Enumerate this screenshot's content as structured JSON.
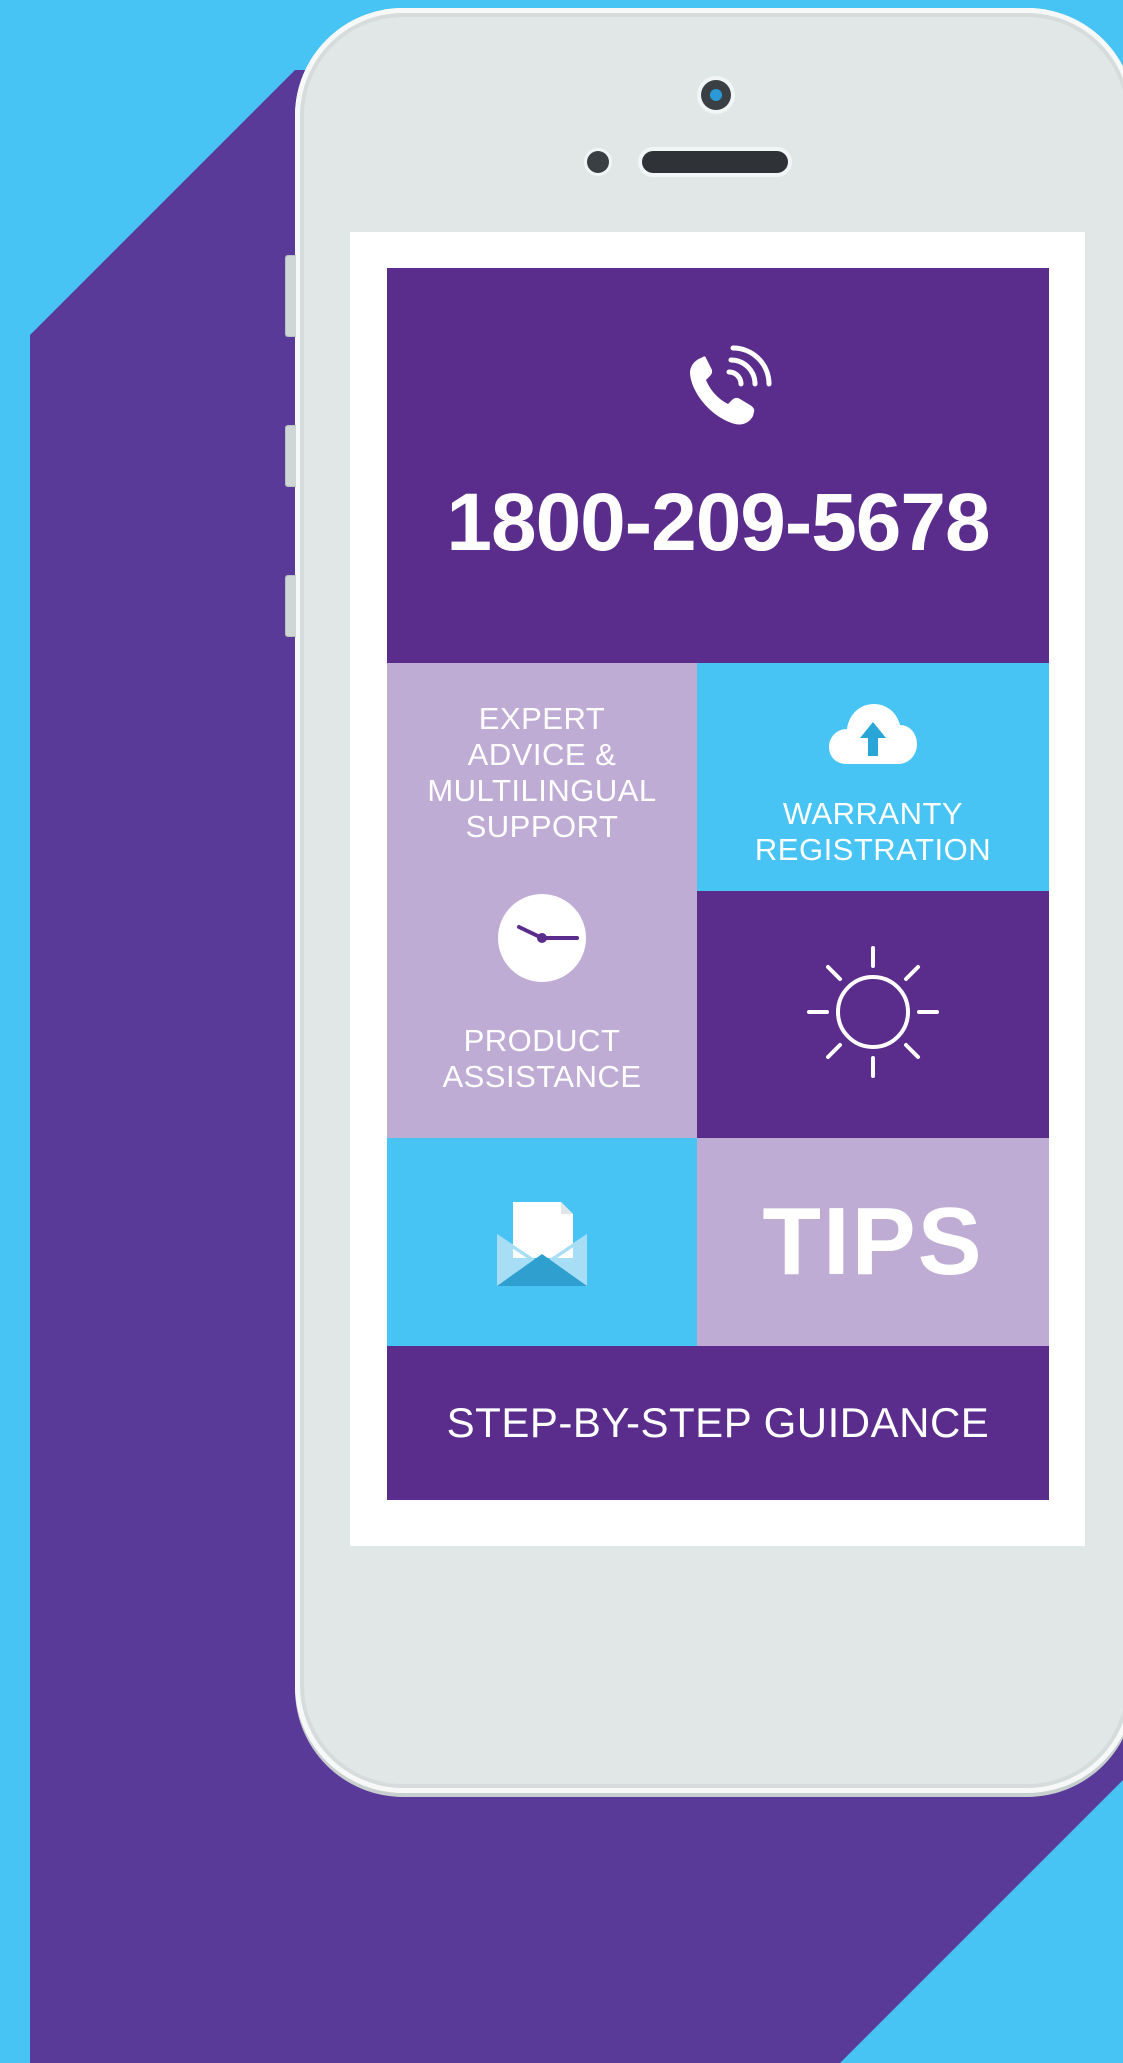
{
  "hotline": {
    "number": "1800-209-5678",
    "icon": "phone-ringing-icon"
  },
  "tiles": {
    "expert": {
      "label": "EXPERT\nADVICE &\nMULTILINGUAL\nSUPPORT"
    },
    "warranty": {
      "label": "WARRANTY\nREGISTRATION",
      "icon": "cloud-upload-icon"
    },
    "product": {
      "label": "PRODUCT\nASSISTANCE",
      "icon": "clock-icon"
    },
    "sun": {
      "icon": "sun-icon"
    },
    "mail": {
      "icon": "envelope-icon"
    },
    "tips": {
      "label": "TIPS"
    },
    "guidance": {
      "label": "STEP-BY-STEP GUIDANCE"
    }
  },
  "colors": {
    "background": "#47c4f3",
    "shadow": "#5a3a98",
    "purple": "#5a2d8c",
    "lilac": "#bfacd4",
    "sky": "#47c4f3",
    "phone_body": "#e1e7e6"
  }
}
